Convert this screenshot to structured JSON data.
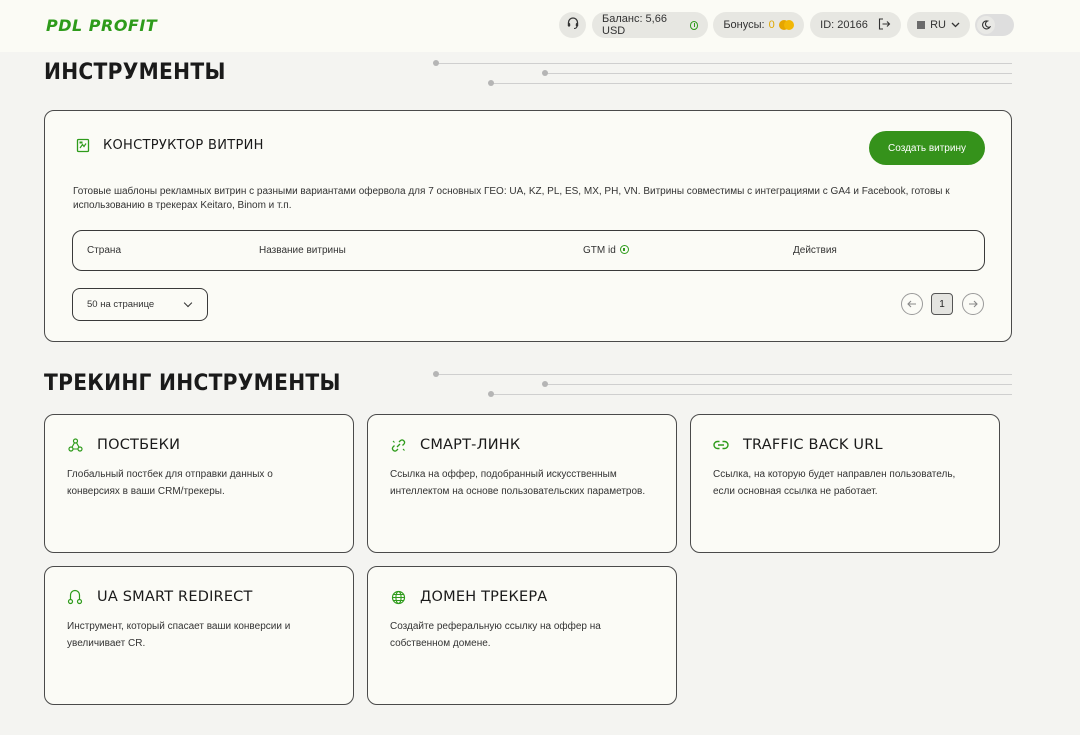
{
  "header": {
    "logo": "PDL PROFIT",
    "balance": "Баланс: 5,66 USD",
    "bonus_label": "Бонусы:",
    "bonus_value": "0",
    "user_id": "ID: 20166",
    "language": "RU"
  },
  "tools_section": {
    "title": "ИНСТРУМЕНТЫ"
  },
  "constructor": {
    "title": "КОНСТРУКТОР ВИТРИН",
    "create_button": "Создать витрину",
    "description": "Готовые шаблоны рекламных витрин с разными вариантами офервола для 7 основных ГЕО: UA, KZ, PL, ES, MX, PH, VN. Витрины совместимы с интеграциями с GA4 и Facebook, готовы к использованию в трекерах Keitaro, Binom и т.п.",
    "table": {
      "col_country": "Страна",
      "col_name": "Название витрины",
      "col_gtm": "GTM id",
      "col_actions": "Действия"
    },
    "per_page": "50 на странице",
    "current_page": "1"
  },
  "tracking_section": {
    "title": "ТРЕКИНГ ИНСТРУМЕНТЫ",
    "cards": [
      {
        "title": "ПОСТБЕКИ",
        "description": "Глобальный постбек для отправки данных о конверсиях в ваши CRM/трекеры."
      },
      {
        "title": "СМАРТ-ЛИНК",
        "description": "Ссылка на оффер, подобранный искусственным интеллектом на основе пользовательских параметров."
      },
      {
        "title": "TRAFFIC BACK URL",
        "description": "Ссылка, на которую будет направлен пользователь, если основная ссылка не работает."
      },
      {
        "title": "UA SMART REDIRECT",
        "description": "Инструмент, который спасает ваши конверсии и увеличивает CR."
      },
      {
        "title": "ДОМЕН ТРЕКЕРА",
        "description": "Создайте реферальную ссылку на оффер на собственном домене."
      }
    ]
  },
  "colors": {
    "accent": "#35921b",
    "background": "#f4f4f1",
    "card": "#fbfbf6"
  }
}
